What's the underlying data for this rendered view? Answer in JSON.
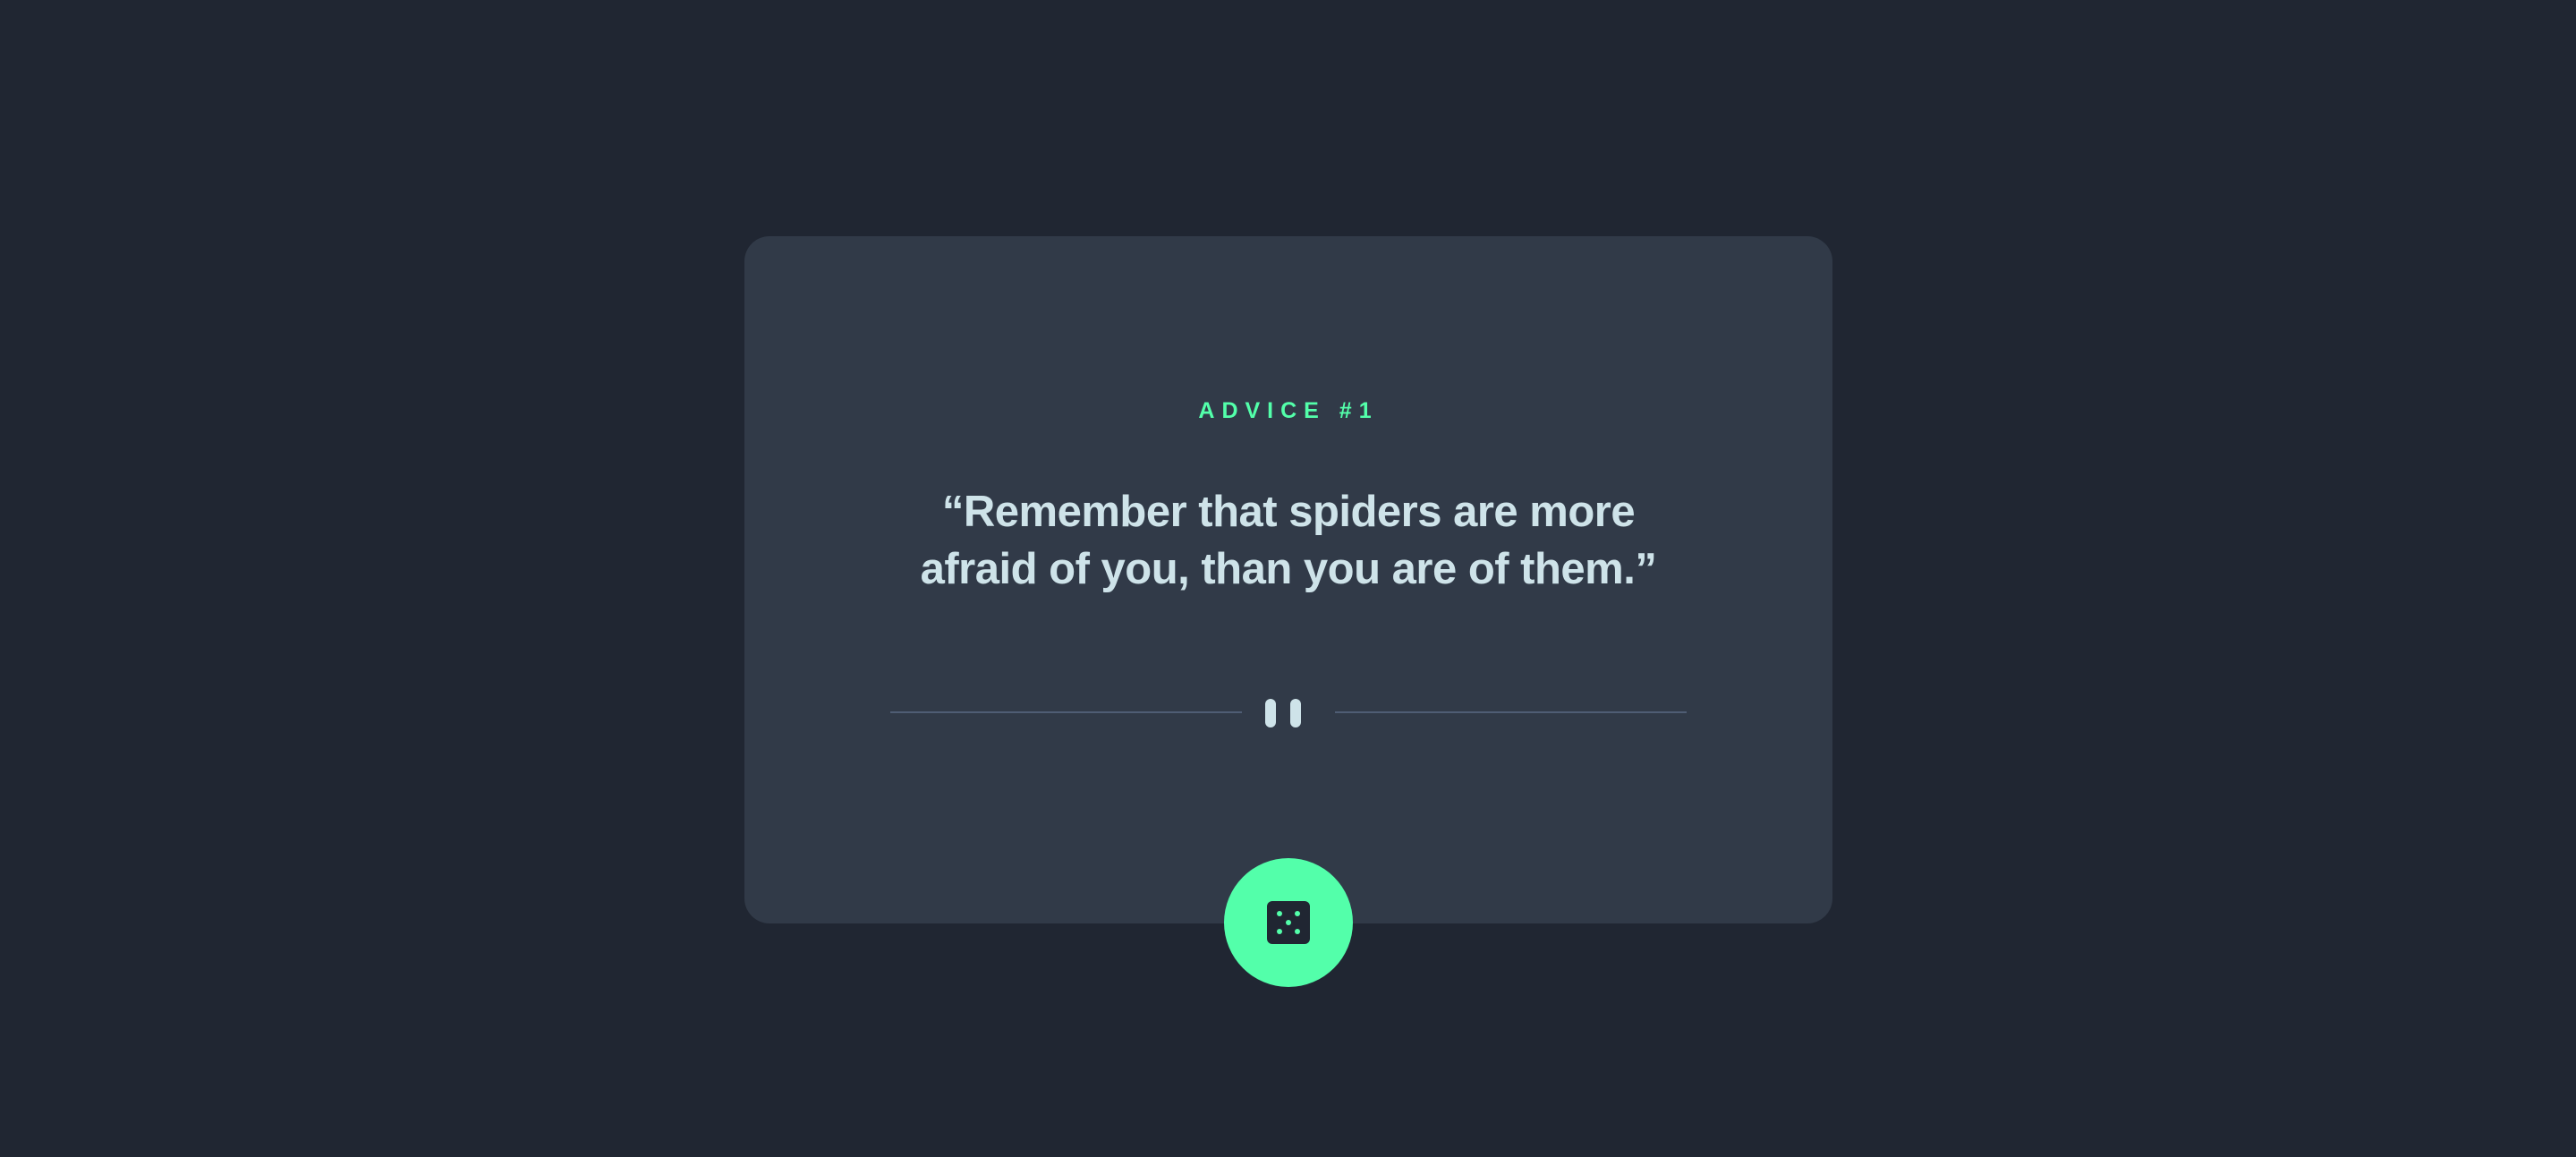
{
  "advice": {
    "id_label": "ADVICE #1",
    "quote": "“Remember that spiders are more afraid of you, than you are of them.”"
  },
  "icons": {
    "divider": "pause-icon",
    "button": "dice-icon"
  },
  "colors": {
    "background": "#202632",
    "card": "#313a48",
    "accent": "#53ffaa",
    "text": "#cee3e9",
    "divider": "#4f5d74"
  }
}
